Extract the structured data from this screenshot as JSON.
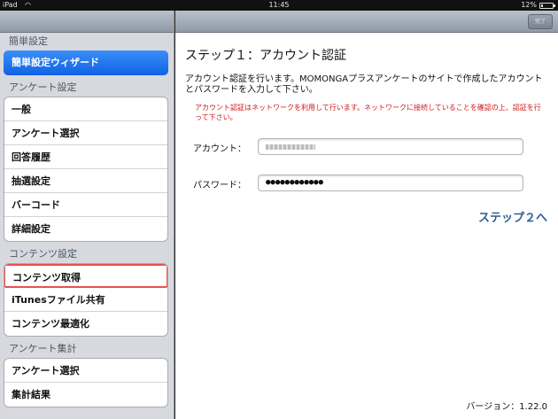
{
  "statusbar": {
    "carrier": "iPad",
    "time": "11:45",
    "battery": "12%"
  },
  "main": {
    "done_label": "完了",
    "step_title": "ステップ１：アカウント認証",
    "description": "アカウント認証を行います。MOMONGAプラスアンケートのサイトで作成したアカウントとパスワードを入力して下さい。",
    "warning": "アカウント認証はネットワークを利用して行います。ネットワークに接続していることを確認の上、認証を行って下さい。",
    "account_label": "アカウント：",
    "password_label": "パスワード：",
    "password_value": "●●●●●●●●●●●●",
    "next_label": "ステップ２へ",
    "version": "バージョン：1.22.0"
  },
  "sidebar": {
    "sections": [
      {
        "header": "簡単設定",
        "items": [
          "簡単設定ウィザード"
        ]
      },
      {
        "header": "アンケート設定",
        "items": [
          "一般",
          "アンケート選択",
          "回答履歴",
          "抽選設定",
          "バーコード",
          "詳細設定"
        ]
      },
      {
        "header": "コンテンツ設定",
        "items": [
          "コンテンツ取得",
          "iTunesファイル共有",
          "コンテンツ最適化"
        ]
      },
      {
        "header": "アンケート集計",
        "items": [
          "アンケート選択",
          "集計結果"
        ]
      }
    ]
  },
  "colors": {
    "accent": "#1062e6",
    "warning": "#d01818",
    "link": "#2b5d95",
    "selection_outline": "#e8524f"
  }
}
